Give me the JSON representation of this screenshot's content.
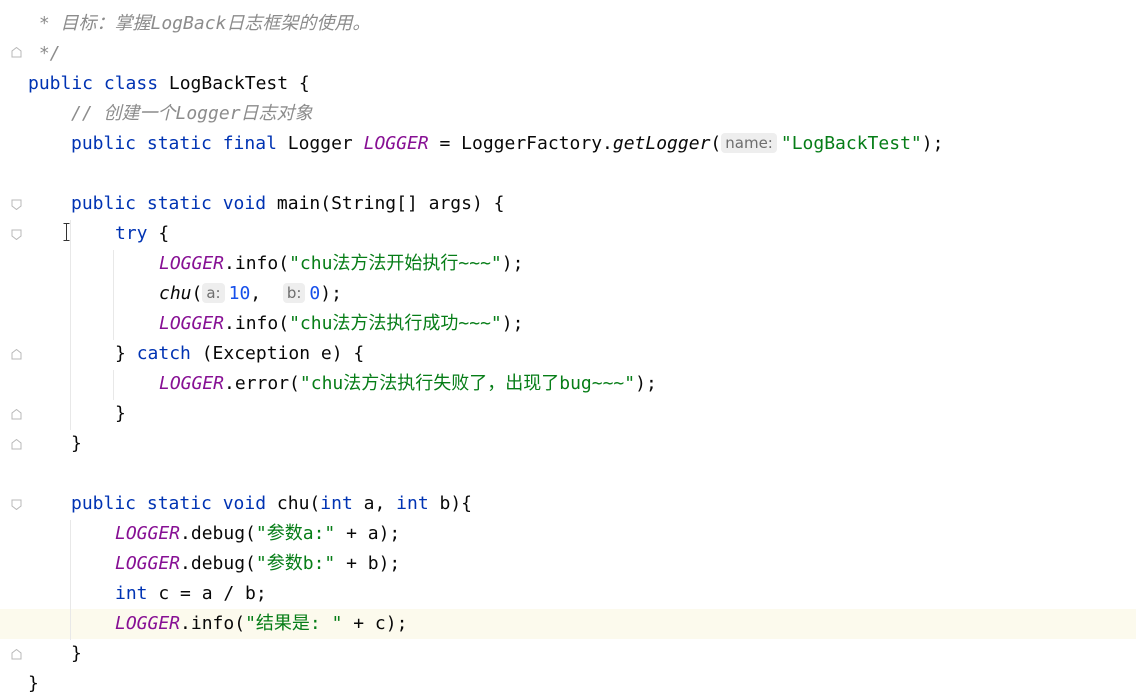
{
  "editor": {
    "lines": {
      "l1": {
        "comment": " * 目标：掌握LogBack日志框架的使用。"
      },
      "l2": {
        "comment": " */"
      },
      "l3": {
        "kw": "public class",
        "name": " LogBackTest {"
      },
      "l4": {
        "comment": "// 创建一个Logger日志对象"
      },
      "l5": {
        "kw": "public static final",
        "type": " Logger ",
        "field": "LOGGER",
        "mid": " = LoggerFactory.",
        "method": "getLogger",
        "open": "(",
        "hint": "name:",
        "str": "\"LogBackTest\"",
        "close": ");"
      },
      "l6": {
        "kw": "public static void",
        "rest": " main(String[] args) {"
      },
      "l7": {
        "kw": "try",
        "rest": " {"
      },
      "l8": {
        "field": "LOGGER",
        "mid": ".info(",
        "str": "\"chu法方法开始执行~~~\"",
        "close": ");"
      },
      "l9": {
        "method": "chu",
        "open": "(",
        "hint_a": "a:",
        "num_a": "10",
        "sep": ",  ",
        "hint_b": "b:",
        "num_b": "0",
        "close": ");"
      },
      "l10": {
        "field": "LOGGER",
        "mid": ".info(",
        "str": "\"chu法方法执行成功~~~\"",
        "close": ");"
      },
      "l11": {
        "pre": "} ",
        "kw": "catch",
        "rest": " (Exception e) {"
      },
      "l12": {
        "field": "LOGGER",
        "mid": ".error(",
        "str": "\"chu法方法执行失败了，出现了bug~~~\"",
        "close": ");"
      },
      "l13": {
        "text": "}"
      },
      "l14": {
        "text": "}"
      },
      "l15": {
        "kw": "public static void",
        "name": " chu(",
        "kw2": "int",
        "mid": " a, ",
        "kw3": "int",
        "rest": " b){"
      },
      "l16": {
        "field": "LOGGER",
        "mid": ".debug(",
        "str": "\"参数a:\"",
        "rest": " + a);"
      },
      "l17": {
        "field": "LOGGER",
        "mid": ".debug(",
        "str": "\"参数b:\"",
        "rest": " + b);"
      },
      "l18": {
        "kw": "int",
        "rest": " c = a / b;"
      },
      "l19": {
        "field": "LOGGER",
        "mid": ".info(",
        "str": "\"结果是: \"",
        "rest": " + c);"
      },
      "l20": {
        "text": "}"
      },
      "l21": {
        "text": "}"
      }
    },
    "colors": {
      "keyword": "#0033b3",
      "static_field": "#871094",
      "string": "#067d17",
      "number": "#1750eb",
      "comment": "#8c8c8c",
      "current_line": "#fcfaed"
    }
  }
}
